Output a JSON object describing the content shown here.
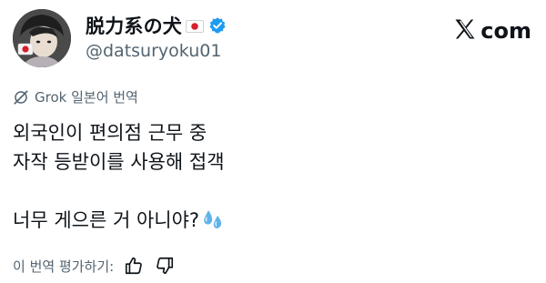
{
  "header": {
    "display_name": "脱力系の犬",
    "handle": "@datsuryoku01",
    "site_logo_text": "com",
    "flag_icon": "japan-flag-icon",
    "verified_icon": "verified-badge-icon"
  },
  "translation": {
    "label": "Grok 일본어 번역"
  },
  "tweet": {
    "line1": "외국인이 편의점 근무 중",
    "line2": "자작 등받이를 사용해 접객",
    "line3": "너무 게으른 거 아니야?",
    "emoji": "sweat-droplets-icon"
  },
  "rating": {
    "label": "이 번역 평가하기:",
    "like_icon": "thumbs-up-icon",
    "dislike_icon": "thumbs-down-icon"
  },
  "colors": {
    "text": "#0f1419",
    "secondary": "#536471",
    "verified": "#1d9bf0"
  }
}
